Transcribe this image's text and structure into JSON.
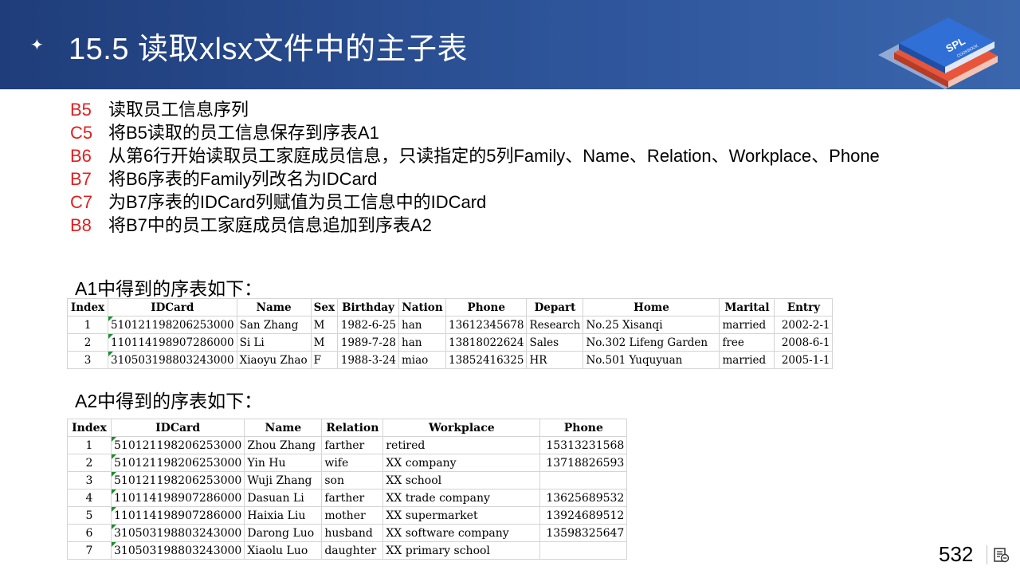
{
  "header": {
    "bullet": "✦",
    "title": "15.5  读取xlsx文件中的主子表"
  },
  "logo": {
    "text_main": "SPL",
    "text_sub": "COOKBOOK",
    "colors": [
      "#2f6fd6",
      "#e8553a",
      "#b9cbe8"
    ]
  },
  "steps": [
    {
      "code": "B5",
      "text": "读取员工信息序列"
    },
    {
      "code": "C5",
      "text": "将B5读取的员工信息保存到序表A1"
    },
    {
      "code": "B6",
      "text": "从第6行开始读取员工家庭成员信息，只读指定的5列Family、Name、Relation、Workplace、Phone"
    },
    {
      "code": "B7",
      "text": "将B6序表的Family列改名为IDCard"
    },
    {
      "code": "C7",
      "text": "为B7序表的IDCard列赋值为员工信息中的IDCard"
    },
    {
      "code": "B8",
      "text": "将B7中的员工家庭成员信息追加到序表A2"
    }
  ],
  "table1": {
    "caption": "A1中得到的序表如下：",
    "headers": [
      "Index",
      "IDCard",
      "Name",
      "Sex",
      "Birthday",
      "Nation",
      "Phone",
      "Depart",
      "Home",
      "Marital",
      "Entry"
    ],
    "rows": [
      [
        "1",
        "510121198206253000",
        "San Zhang",
        "M",
        "1982-6-25",
        "han",
        "13612345678",
        "Research",
        "No.25 Xisanqi",
        "married",
        "2002-2-1"
      ],
      [
        "2",
        "110114198907286000",
        "Si Li",
        "M",
        "1989-7-28",
        "han",
        "13818022624",
        "Sales",
        "No.302 Lifeng Garden",
        "free",
        "2008-6-1"
      ],
      [
        "3",
        "310503198803243000",
        "Xiaoyu Zhao",
        "F",
        "1988-3-24",
        "miao",
        "13852416325",
        "HR",
        "No.501 Yuquyuan",
        "married",
        "2005-1-1"
      ]
    ]
  },
  "table2": {
    "caption": "A2中得到的序表如下：",
    "headers": [
      "Index",
      "IDCard",
      "Name",
      "Relation",
      "Workplace",
      "Phone"
    ],
    "rows": [
      [
        "1",
        "510121198206253000",
        "Zhou Zhang",
        "farther",
        "retired",
        "15313231568"
      ],
      [
        "2",
        "510121198206253000",
        "Yin Hu",
        "wife",
        "XX company",
        "13718826593"
      ],
      [
        "3",
        "510121198206253000",
        "Wuji Zhang",
        "son",
        "XX school",
        ""
      ],
      [
        "4",
        "110114198907286000",
        "Dasuan Li",
        "farther",
        "XX trade company",
        "13625689532"
      ],
      [
        "5",
        "110114198907286000",
        "Haixia Liu",
        "mother",
        "XX supermarket",
        "13924689512"
      ],
      [
        "6",
        "310503198803243000",
        "Darong Luo",
        "husband",
        "XX software company",
        "13598325647"
      ],
      [
        "7",
        "310503198803243000",
        "Xiaolu Luo",
        "daughter",
        "XX primary school",
        ""
      ]
    ]
  },
  "footer": {
    "page_number": "532",
    "icon": "presentation-notes-icon"
  }
}
